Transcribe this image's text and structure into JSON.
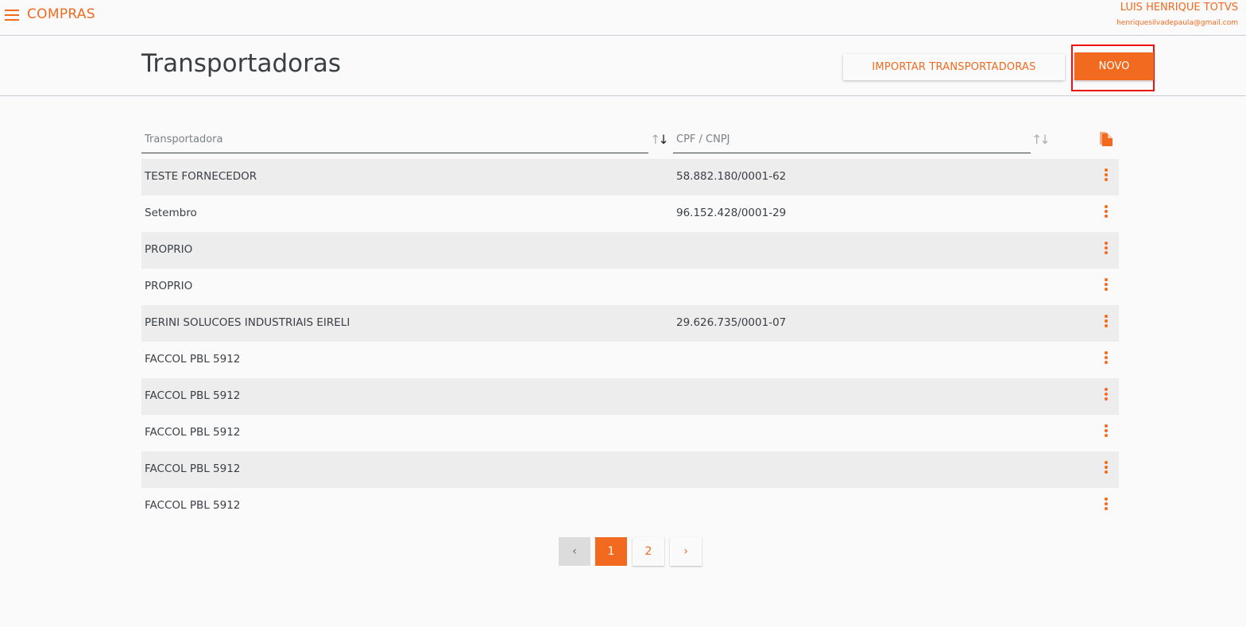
{
  "app": {
    "title": "COMPRAS",
    "user_name": "LUIS HENRIQUE TOTVS",
    "user_email": "henriquesilvadepaula@gmail.com"
  },
  "page": {
    "title": "Transportadoras",
    "import_button": "IMPORTAR TRANSPORTADORAS",
    "new_button": "NOVO"
  },
  "filters": {
    "name_placeholder": "Transportadora",
    "doc_placeholder": "CPF / CNPJ"
  },
  "rows": [
    {
      "name": "TESTE FORNECEDOR",
      "doc": "58.882.180/0001-62"
    },
    {
      "name": "Setembro",
      "doc": "96.152.428/0001-29"
    },
    {
      "name": "PROPRIO",
      "doc": ""
    },
    {
      "name": "PROPRIO",
      "doc": ""
    },
    {
      "name": "PERINI SOLUCOES INDUSTRIAIS EIRELI",
      "doc": "29.626.735/0001-07"
    },
    {
      "name": "FACCOL PBL 5912",
      "doc": ""
    },
    {
      "name": "FACCOL PBL 5912",
      "doc": ""
    },
    {
      "name": "FACCOL PBL 5912",
      "doc": ""
    },
    {
      "name": "FACCOL PBL 5912",
      "doc": ""
    },
    {
      "name": "FACCOL PBL 5912",
      "doc": ""
    }
  ],
  "pagination": {
    "prev": "‹",
    "pages": [
      "1",
      "2"
    ],
    "current": "1",
    "next": "›"
  },
  "colors": {
    "accent": "#f26a1f",
    "highlight": "#ee1111"
  }
}
